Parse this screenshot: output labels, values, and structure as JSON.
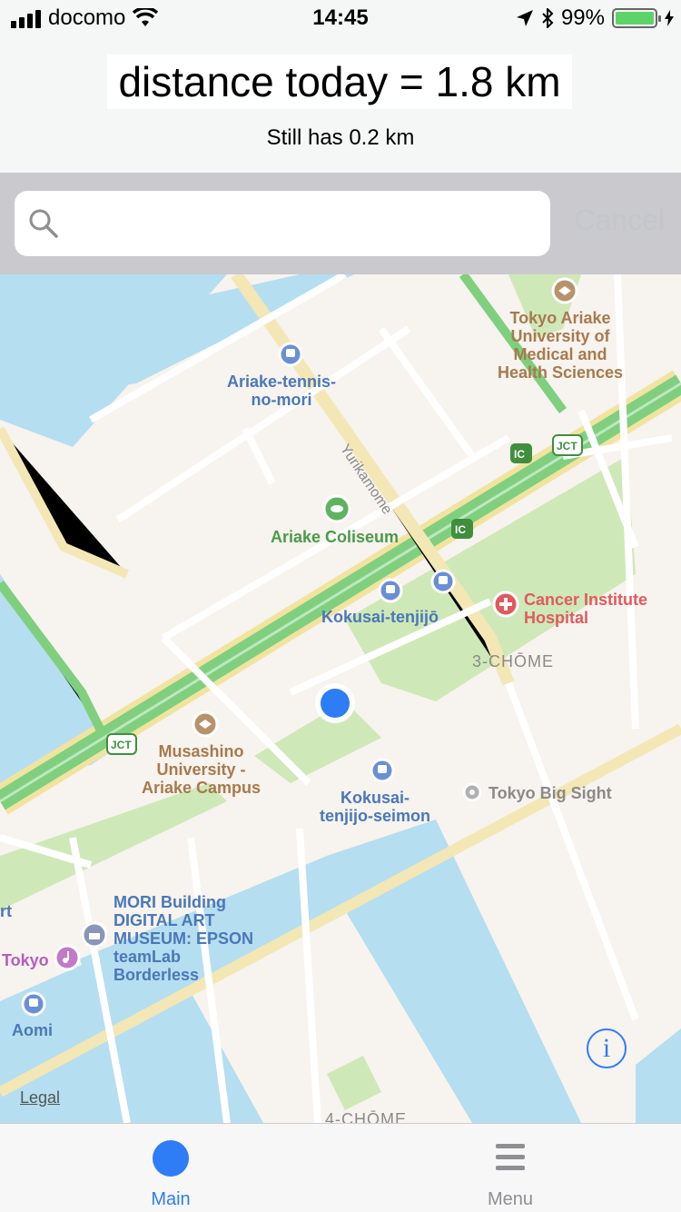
{
  "status_bar": {
    "carrier": "docomo",
    "time": "14:45",
    "battery": "99%",
    "battery_level": 0.99,
    "colors": {
      "battery_fill": "#5dd36a"
    }
  },
  "header": {
    "title": "distance today = 1.8 km",
    "subtitle": "Still has 0.2 km"
  },
  "search": {
    "placeholder": "",
    "cancel_label": "Cancel"
  },
  "map": {
    "labels": {
      "tokyo_ariake_univ": [
        "Tokyo Ariake",
        "University of",
        "Medical and",
        "Health Sciences"
      ],
      "ariake_tennis": [
        "Ariake-tennis-",
        "no-mori"
      ],
      "yurikamome": "Yurikamome",
      "ariake_coliseum": "Ariake Coliseum",
      "kokusai_tenjijo": "Kokusai-tenjijō",
      "cancer_institute": [
        "Cancer Institute",
        "Hospital"
      ],
      "chome3": "3-CHŌME",
      "musashino": [
        "Musashino",
        "University -",
        "Ariake Campus"
      ],
      "kokusai_seimon": [
        "Kokusai-",
        "tenjijo-seimon"
      ],
      "tokyo_big_sight": "Tokyo Big Sight",
      "mori_building": [
        "MORI Building",
        "DIGITAL ART",
        "MUSEUM: EPSON",
        "teamLab",
        "Borderless"
      ],
      "rt": "rt",
      "tokyo": "Tokyo",
      "aomi": "Aomi",
      "chome4": "4-CHŌME",
      "jct_1": "JCT",
      "jct_2": "JCT",
      "ic_1": "IC",
      "ic_2": "IC"
    },
    "legal_label": "Legal",
    "info_label": "i",
    "colors": {
      "land": "#f7f3ee",
      "water": "#b5def0",
      "park": "#cfe8b8",
      "highway": "#7fcf7f",
      "road": "#ffffff",
      "user_location": "#2e7cf6"
    }
  },
  "tabs": [
    {
      "label": "Main",
      "icon": "location-dot-icon",
      "selected": true
    },
    {
      "label": "Menu",
      "icon": "hamburger-menu-icon",
      "selected": false
    }
  ]
}
